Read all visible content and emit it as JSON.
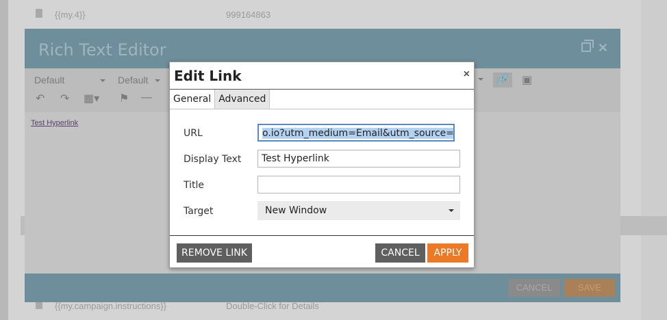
{
  "background": {
    "rows": [
      {
        "c1": "{{my.4}}",
        "c2": "999164863"
      },
      {
        "c1": "{{my.campaign.instructions}}",
        "c2": "Double-Click for Details"
      },
      {
        "c1": "",
        "c2": ""
      }
    ]
  },
  "rte": {
    "title": "Rich Text Editor",
    "toolbar": {
      "font_select": "Default",
      "size_select": "Default"
    },
    "body_link": "Test Hyperlink",
    "cancel_label": "CANCEL",
    "save_label": "SAVE"
  },
  "dialog": {
    "title": "Edit Link",
    "close_glyph": "×",
    "tabs": [
      {
        "label": "General",
        "active": true
      },
      {
        "label": "Advanced",
        "active": false
      }
    ],
    "fields": {
      "url": {
        "label": "URL",
        "value": "o.io?utm_medium=Email&utm_source=Jeto"
      },
      "display_text": {
        "label": "Display Text",
        "value": "Test Hyperlink"
      },
      "title": {
        "label": "Title",
        "value": ""
      },
      "target": {
        "label": "Target",
        "value": "New Window"
      }
    },
    "buttons": {
      "remove_link": "REMOVE LINK",
      "cancel": "CANCEL",
      "apply": "APPLY"
    }
  },
  "colors": {
    "accent_apply": "#ea7a27",
    "header_blue": "#6f8e9b",
    "selection": "#b3d2f1"
  }
}
